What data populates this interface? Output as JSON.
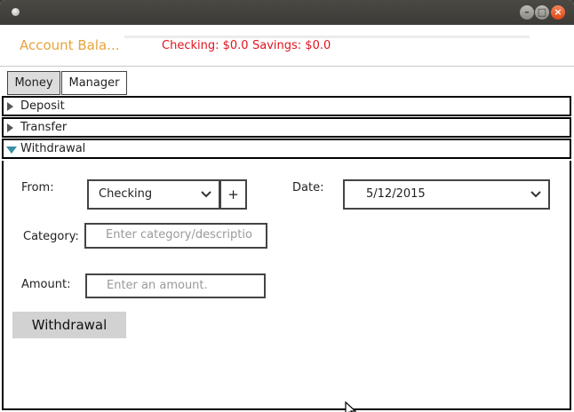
{
  "window": {
    "title": "",
    "controls": {
      "minimize": "–",
      "maximize": "□",
      "close": "×"
    }
  },
  "header": {
    "account_label": "Account Bala...",
    "checking_text": "Checking: $0.0",
    "savings_text": "Savings: $0.0",
    "colors": {
      "account_label": "#e8a33c",
      "balance": "#e0141e"
    }
  },
  "tabs": [
    {
      "label": "Money",
      "selected": true
    },
    {
      "label": "Manager",
      "selected": false
    }
  ],
  "accordion": [
    {
      "label": "Deposit",
      "expanded": false
    },
    {
      "label": "Transfer",
      "expanded": false
    },
    {
      "label": "Withdrawal",
      "expanded": true
    }
  ],
  "form": {
    "from_label": "From:",
    "from_value": "Checking",
    "add_account_label": "+",
    "date_label": "Date:",
    "date_value": "5/12/2015",
    "category_label": "Category:",
    "category_placeholder": "Enter category/descriptio",
    "amount_label": "Amount:",
    "amount_placeholder": "Enter an amount.",
    "submit_label": "Withdrawal"
  },
  "icons": {
    "collapsed": "triangle-right-icon",
    "expanded": "triangle-down-icon",
    "dropdown": "chevron-down-icon"
  }
}
